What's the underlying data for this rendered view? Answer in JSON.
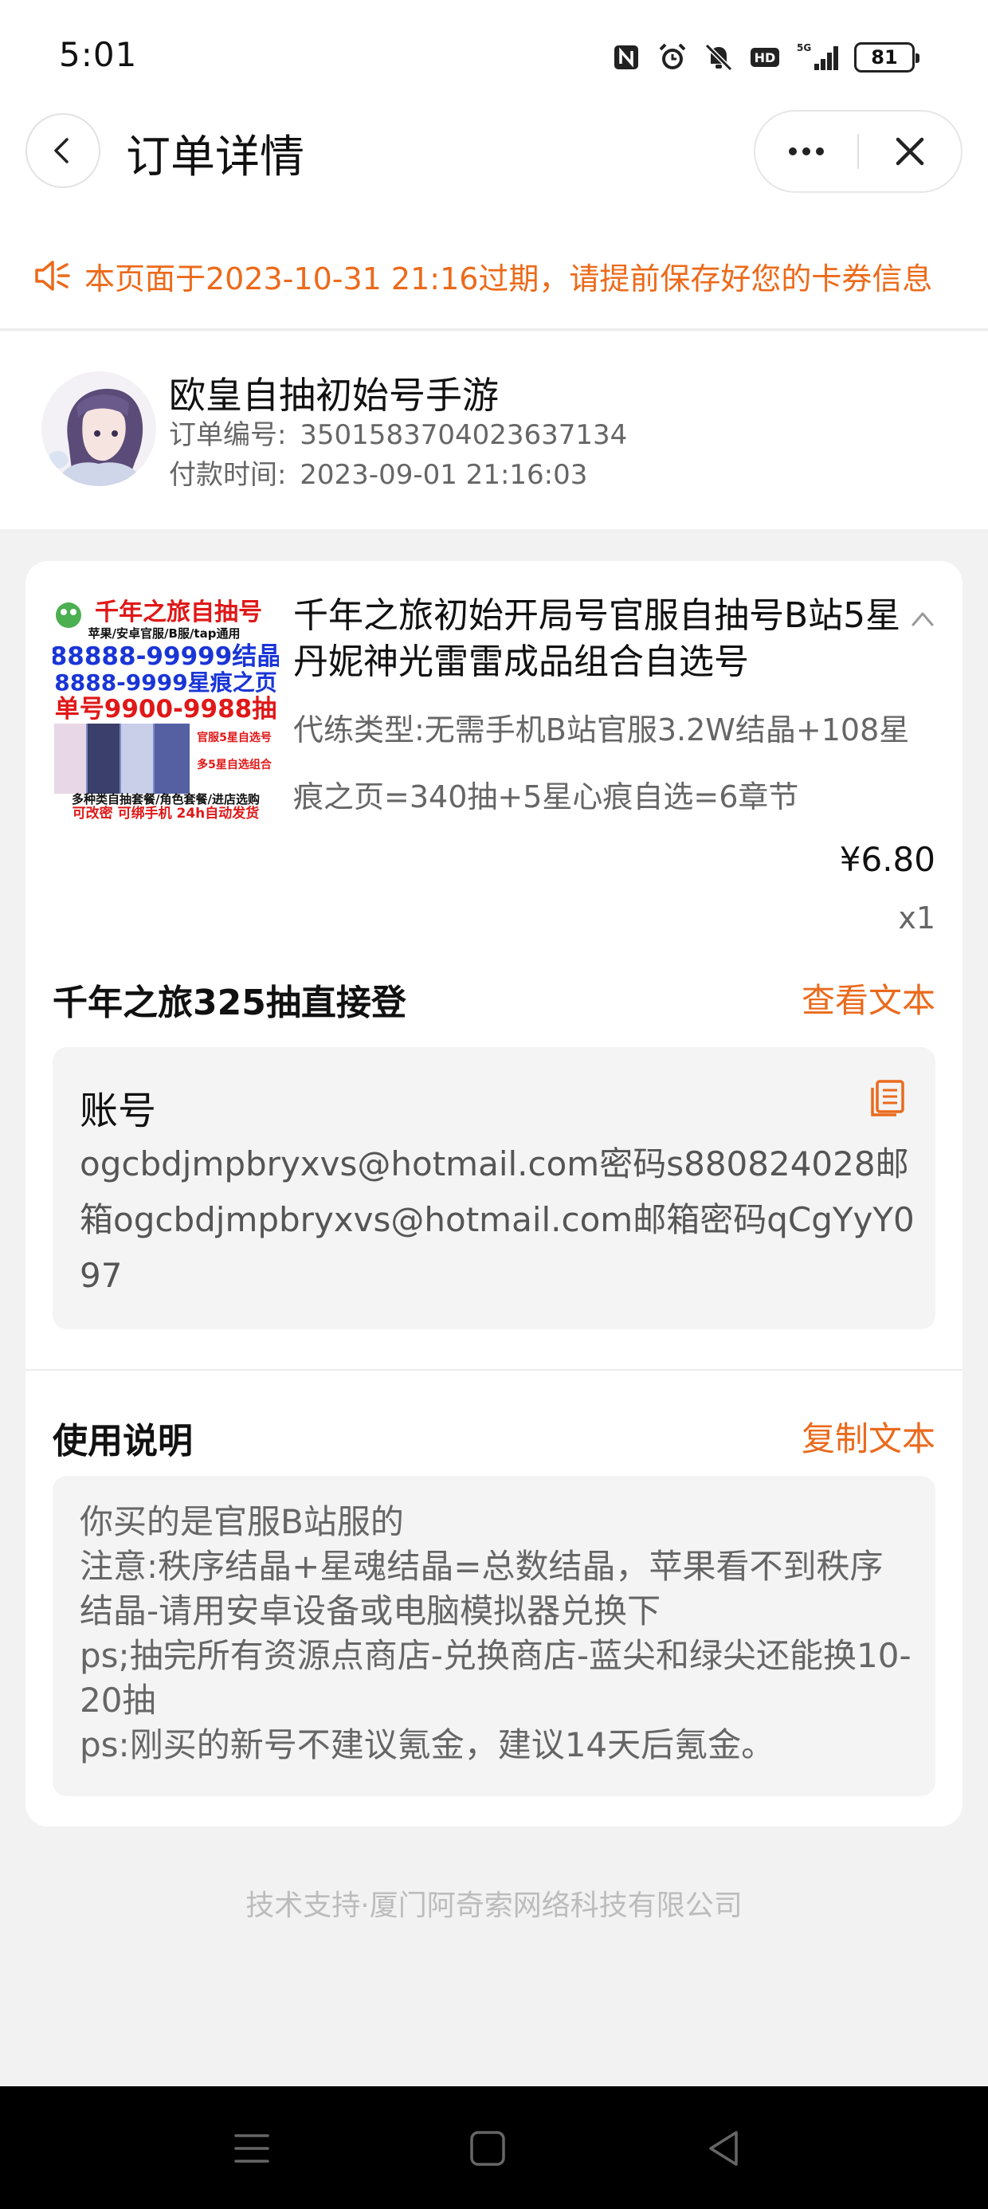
{
  "status_bar": {
    "time": "5:01",
    "network": "5G",
    "battery": "81",
    "icons": [
      "nfc-icon",
      "alarm-icon",
      "bell-off-icon",
      "hd-icon",
      "signal-icon",
      "battery-icon"
    ]
  },
  "nav": {
    "title": "订单详情"
  },
  "notice": {
    "text": "本页面于2023-10-31 21:16过期，请提前保存好您的卡券信息",
    "color": "#ec6a1a"
  },
  "shop": {
    "name": "欧皇自抽初始号手游",
    "order_no_label": "订单编号:",
    "order_no": "3501583704023637134",
    "pay_time_label": "付款时间:",
    "pay_time": "2023-09-01 21:16:03"
  },
  "product": {
    "image_text": {
      "line1": "千年之旅自抽号",
      "line2": "苹果/安卓官服/B服/tap通用",
      "line3": "88888-99999结晶",
      "line4": "8888-9999星痕之页",
      "line5": "单号9900-9988抽",
      "line6": "官服5星自选号",
      "line7": "多5星自选组合",
      "line8": "多种类自抽套餐/角色套餐/进店选购",
      "line9": "可改密 可绑手机 24h自动发货"
    },
    "title": "千年之旅初始开局号官服自抽号B站5星丹妮神光雷雷成品组合自选号",
    "spec": "代练类型:无需手机B站官服3.2W结晶+108星痕之页=340抽+5星心痕自选=6章节",
    "price": "¥6.80",
    "qty": "x1"
  },
  "account_section": {
    "title": "千年之旅325抽直接登",
    "link": "查看文本",
    "label": "账号",
    "value": "ogcbdjmpbryxvs@hotmail.com密码s880824028邮箱ogcbdjmpbryxvs@hotmail.com邮箱密码qCgYyY097"
  },
  "instructions": {
    "title": "使用说明",
    "link": "复制文本",
    "lines": [
      "你买的是官服B站服的",
      "注意:秩序结晶+星魂结晶=总数结晶，苹果看不到秩序结晶-请用安卓设备或电脑模拟器兑换下",
      "ps;抽完所有资源点商店-兑换商店-蓝尖和绿尖还能换10-20抽",
      "ps:刚买的新号不建议氪金，建议14天后氪金。"
    ]
  },
  "footer": {
    "text": "技术支持·厦门阿奇索网络科技有限公司"
  },
  "colors": {
    "accent": "#ea6a1c",
    "background": "#f2f2f2"
  }
}
